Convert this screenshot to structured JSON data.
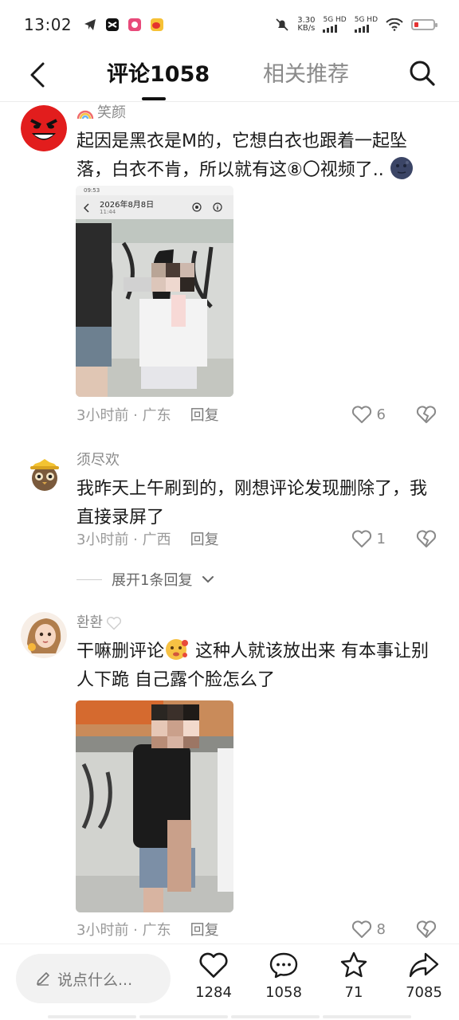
{
  "status_bar": {
    "time": "13:02",
    "net_speed_value": "3.30",
    "net_speed_unit": "KB/s",
    "sim1": "5G HD",
    "sim2": "5G HD"
  },
  "header": {
    "tab_comments": "评论1058",
    "tab_related": "相关推荐"
  },
  "comments": [
    {
      "name": "笑颜",
      "text": "起因是黑衣是M的，它想白衣也跟着一起坠落，白衣不肯，所以就有这⑧〇视频了..",
      "time_location": "3小时前 · 广东",
      "reply": "回复",
      "likes": "6",
      "screenshot_date": "2026年8月8日",
      "screenshot_time": "11:44",
      "screenshot_clock": "09:53"
    },
    {
      "name": "须尽欢",
      "text": "我昨天上午刷到的，刚想评论发现删除了，我直接录屏了",
      "time_location": "3小时前 · 广西",
      "reply": "回复",
      "likes": "1"
    },
    {
      "name": "환환",
      "text_before_emoji": "干嘛删评论",
      "text_after_emoji": " 这种人就该放出来 有本事让别人下跪 自己露个脸怎么了",
      "time_location": "3小时前 · 广东",
      "reply": "回复",
      "likes": "8"
    }
  ],
  "expand_replies": "展开1条回复",
  "bottom_bar": {
    "input_placeholder": "说点什么...",
    "like_count": "1284",
    "comment_count": "1058",
    "favorite_count": "71",
    "share_count": "7085"
  },
  "icons": [
    "back-arrow-icon",
    "search-icon",
    "heart-icon",
    "dislike-heart-icon",
    "chevron-down-icon",
    "pencil-icon",
    "comment-bubble-icon",
    "star-icon",
    "share-arrow-icon"
  ],
  "colors": {
    "text_primary": "#1a1a1a",
    "text_secondary": "#8a8a8a",
    "battery_low": "#e63232"
  }
}
